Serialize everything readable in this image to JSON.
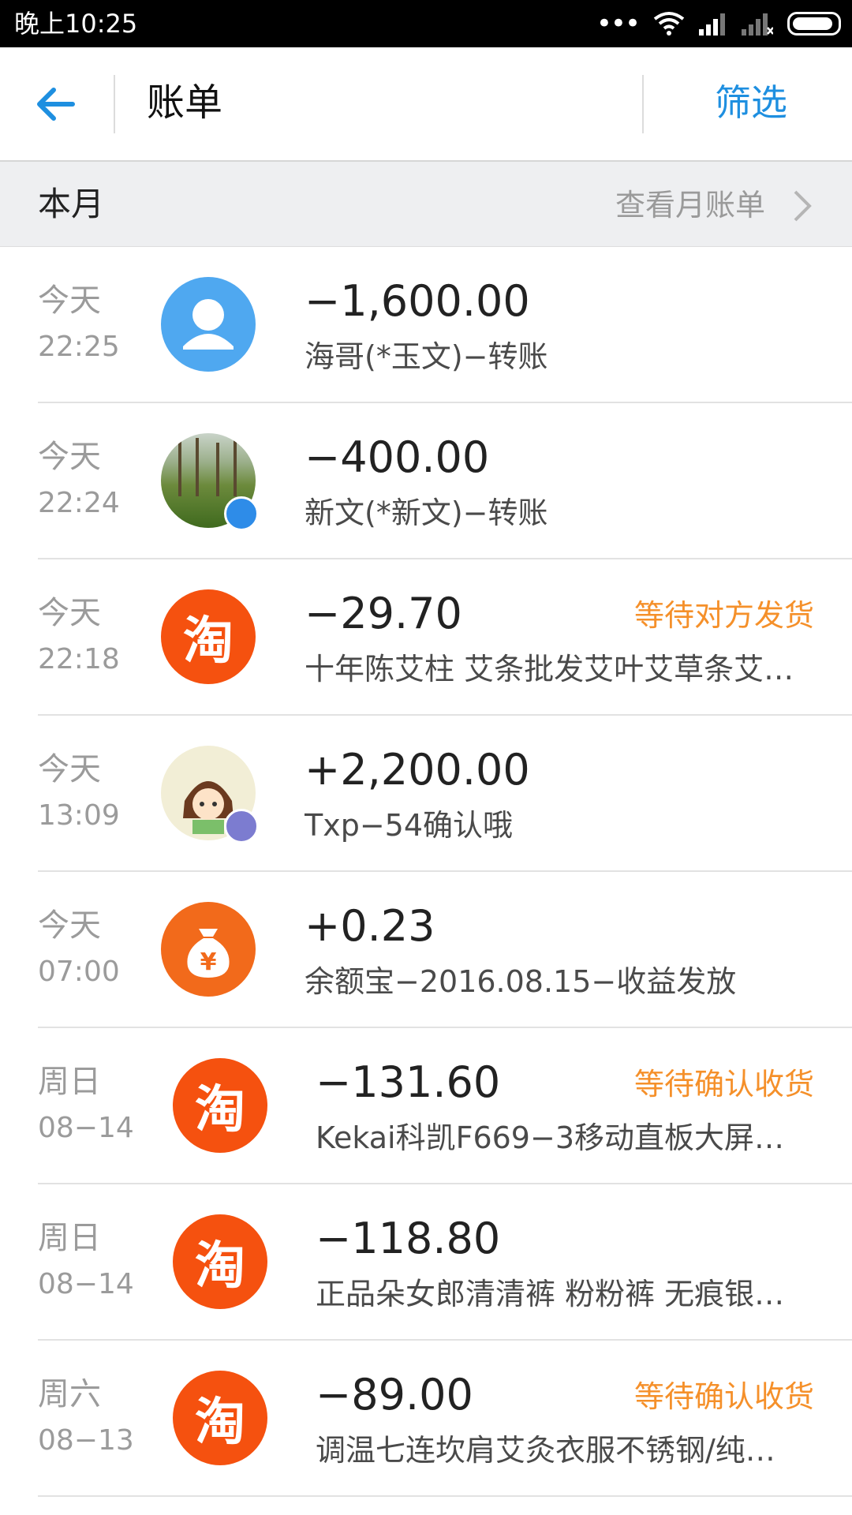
{
  "status_bar": {
    "time": "晚上10:25",
    "dots": "•••",
    "icons": [
      "wifi-icon",
      "signal-icon",
      "signal-no-sim-icon",
      "battery-icon"
    ]
  },
  "header": {
    "title": "账单",
    "filter_label": "筛选",
    "back_icon": "back-arrow-icon"
  },
  "month_bar": {
    "title": "本月",
    "link_label": "查看月账单"
  },
  "colors": {
    "accent": "#1e8fe0",
    "status_tag": "#f5902a",
    "taobao": "#f5510f"
  },
  "transactions": [
    {
      "day": "今天",
      "time": "22:25",
      "amount": "−1,600.00",
      "desc": "海哥(*玉文)−转账",
      "status": "",
      "avatar": "person-icon"
    },
    {
      "day": "今天",
      "time": "22:24",
      "amount": "−400.00",
      "desc": "新文(*新文)−转账",
      "status": "",
      "avatar": "forest-photo"
    },
    {
      "day": "今天",
      "time": "22:18",
      "amount": "−29.70",
      "desc": "十年陈艾柱 艾条批发艾叶艾草条艾…",
      "status": "等待对方发货",
      "avatar": "taobao-icon",
      "avatar_text": "淘"
    },
    {
      "day": "今天",
      "time": "13:09",
      "amount": "+2,200.00",
      "desc": "Txp−54确认哦",
      "status": "",
      "avatar": "cartoon-girl-avatar"
    },
    {
      "day": "今天",
      "time": "07:00",
      "amount": "+0.23",
      "desc": "余额宝−2016.08.15−收益发放",
      "status": "",
      "avatar": "money-bag-icon",
      "avatar_text": "¥"
    },
    {
      "day": "周日",
      "time": "08−14",
      "amount": "−131.60",
      "desc": "Kekai科凯F669−3移动直板大屏…",
      "status": "等待确认收货",
      "avatar": "taobao-icon",
      "avatar_text": "淘"
    },
    {
      "day": "周日",
      "time": "08−14",
      "amount": "−118.80",
      "desc": "正品朵女郎清清裤 粉粉裤 无痕银…",
      "status": "",
      "avatar": "taobao-icon",
      "avatar_text": "淘"
    },
    {
      "day": "周六",
      "time": "08−13",
      "amount": "−89.00",
      "desc": "调温七连坎肩艾灸衣服不锈钢/纯…",
      "status": "等待确认收货",
      "avatar": "taobao-icon",
      "avatar_text": "淘"
    }
  ]
}
